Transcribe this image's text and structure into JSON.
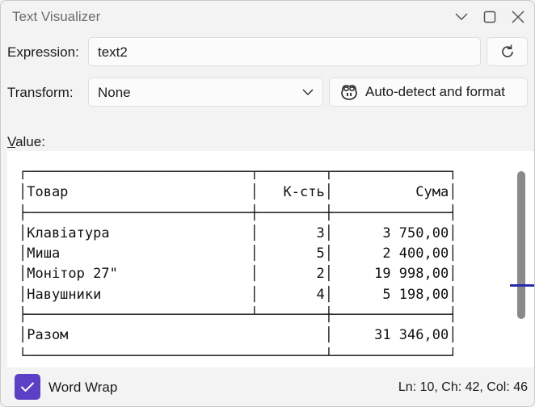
{
  "window": {
    "title": "Text Visualizer",
    "controls": [
      "minimize-icon",
      "maximize-icon",
      "close-icon"
    ]
  },
  "expression": {
    "label": "Expression:",
    "value": "text2",
    "refresh_icon": "refresh-icon"
  },
  "transform": {
    "label": "Transform:",
    "selected": "None",
    "auto_button": {
      "label": "Auto-detect and format",
      "icon": "copilot-icon"
    }
  },
  "value": {
    "label_first": "V",
    "label_rest": "alue:",
    "content_lines": [
      "┌───────────────────────────┬────────┬──────────────┐",
      "│Товар                      │   К-сть│          Сума│",
      "├───────────────────────────┼────────┼──────────────┤",
      "│Клавіатура                 │       3│      3 750,00│",
      "│Миша                       │       5│      2 400,00│",
      "│Монітор 27\"                │       2│     19 998,00│",
      "│Навушники                  │       4│      5 198,00│",
      "├───────────────────────────┴────────┼──────────────┤",
      "│Разом                               │     31 346,00│",
      "└────────────────────────────────────┴──────────────┘"
    ]
  },
  "status": {
    "word_wrap_label": "Word Wrap",
    "word_wrap_checked": true,
    "position": "Ln: 10, Ch: 42, Col: 46"
  },
  "colors": {
    "accent": "#5b3fc4",
    "scroll_marker": "#2b2bb0"
  }
}
